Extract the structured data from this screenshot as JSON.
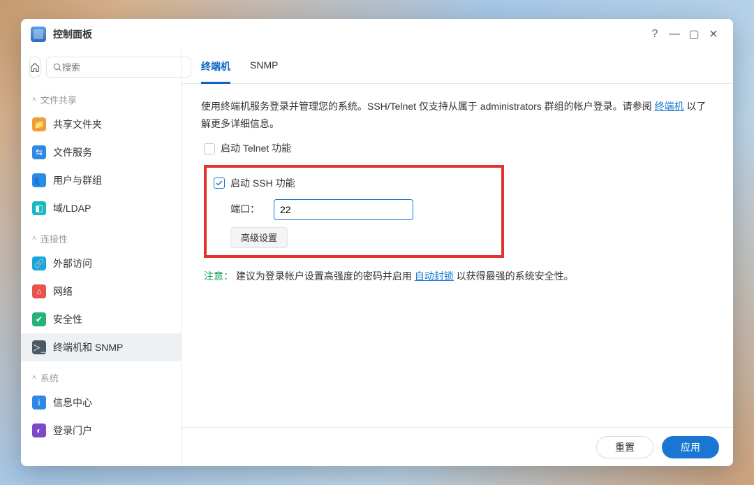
{
  "window": {
    "title": "控制面板"
  },
  "search": {
    "placeholder": "搜索"
  },
  "sidebar": {
    "sections": [
      {
        "label": "文件共享",
        "items": [
          {
            "label": "共享文件夹"
          },
          {
            "label": "文件服务"
          },
          {
            "label": "用户与群组"
          },
          {
            "label": "域/LDAP"
          }
        ]
      },
      {
        "label": "连接性",
        "items": [
          {
            "label": "外部访问"
          },
          {
            "label": "网络"
          },
          {
            "label": "安全性"
          },
          {
            "label": "终端机和 SNMP"
          }
        ]
      },
      {
        "label": "系统",
        "items": [
          {
            "label": "信息中心"
          },
          {
            "label": "登录门户"
          }
        ]
      }
    ]
  },
  "tabs": {
    "terminal": "终端机",
    "snmp": "SNMP"
  },
  "main": {
    "desc_pre": "使用终端机服务登录并管理您的系统。SSH/Telnet 仅支持从属于 administrators 群组的帐户登录。请参阅 ",
    "desc_link": "终端机",
    "desc_post": " 以了解更多详细信息。",
    "telnet": {
      "label": "启动 Telnet 功能",
      "checked": false
    },
    "ssh": {
      "label": "启动 SSH 功能",
      "checked": true,
      "port_label": "端口：",
      "port_value": "22",
      "advanced": "高级设置"
    },
    "note": {
      "label": "注意：",
      "text_pre": "建议为登录帐户设置高强度的密码并启用 ",
      "link": "自动封锁",
      "text_post": " 以获得最强的系统安全性。"
    }
  },
  "footer": {
    "reset": "重置",
    "apply": "应用"
  }
}
